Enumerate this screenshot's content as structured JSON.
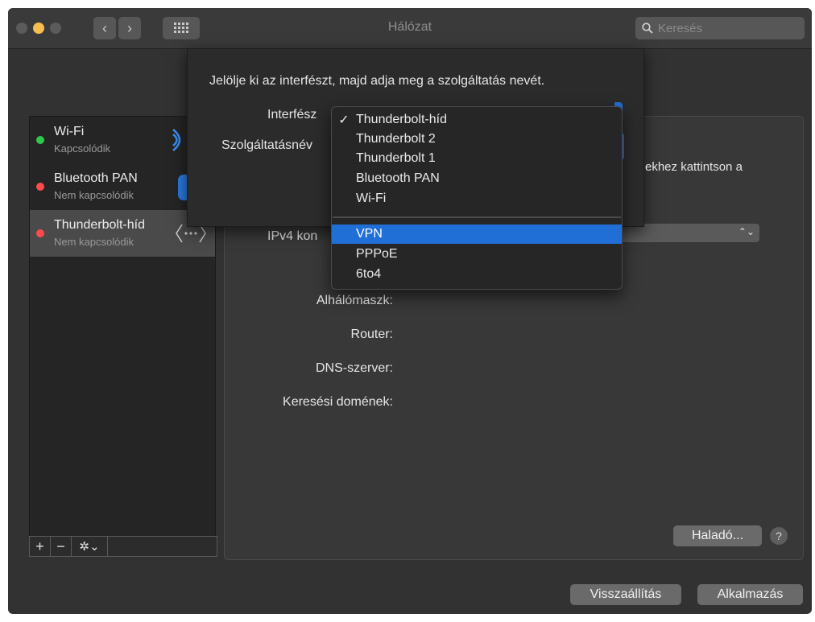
{
  "window": {
    "title": "Hálózat"
  },
  "search": {
    "placeholder": "Keresés"
  },
  "services": [
    {
      "name": "Wi-Fi",
      "status": "Kapcsolódik",
      "color": "#2ec94a"
    },
    {
      "name": "Bluetooth PAN",
      "status": "Nem kapcsolódik",
      "color": "#ff4b4b"
    },
    {
      "name": "Thunderbolt-híd",
      "status": "Nem kapcsolódik",
      "color": "#ff4b4b"
    }
  ],
  "sheet": {
    "instruction": "Jelölje ki az interfészt, majd adja meg a szolgáltatás nevét.",
    "interface_label": "Interfész",
    "service_label": "Szolgáltatásnév",
    "partial_text": "ekhez kattintson a"
  },
  "interface_menu": {
    "selected": "Thunderbolt-híd",
    "highlighted": "VPN",
    "group1": [
      "Thunderbolt-híd",
      "Thunderbolt 2",
      "Thunderbolt 1",
      "Bluetooth PAN",
      "Wi-Fi"
    ],
    "group2": [
      "VPN",
      "PPPoE",
      "6to4"
    ]
  },
  "fields": {
    "ipv4": "IPv4 kon",
    "subnet": "Alhálómaszk:",
    "router": "Router:",
    "dns": "DNS-szerver:",
    "search_domains": "Keresési domének:"
  },
  "buttons": {
    "advanced": "Haladó...",
    "help": "?",
    "revert": "Visszaállítás",
    "apply": "Alkalmazás"
  },
  "accent_color": "#1f6fd6"
}
